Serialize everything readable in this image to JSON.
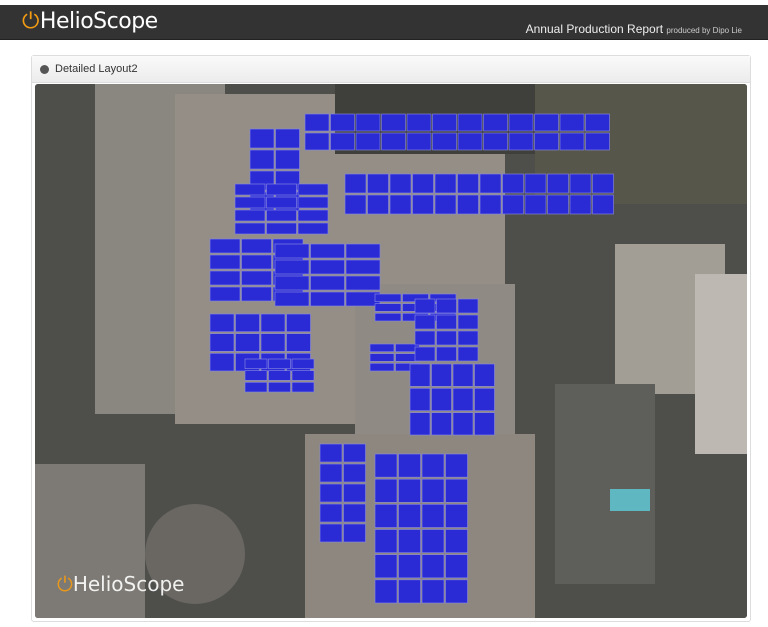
{
  "header": {
    "logo": "HelioScope",
    "report_title": "Annual Production Report",
    "produced_by": "produced by Dipo Lie"
  },
  "panel": {
    "title": "Detailed Layout2",
    "icon": "globe-icon"
  },
  "map": {
    "watermark": "HelioScope",
    "panel_color": "#2b2bd6"
  }
}
